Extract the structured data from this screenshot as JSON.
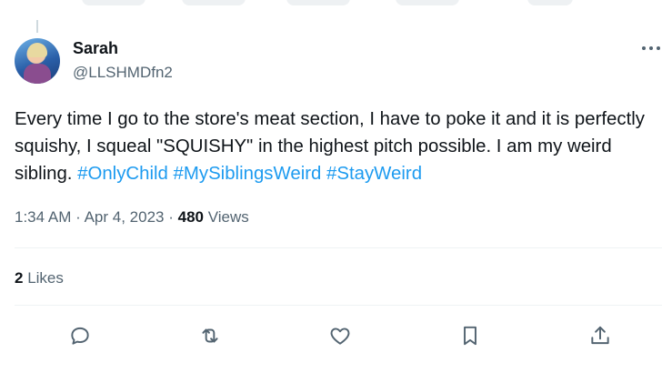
{
  "tweet": {
    "author_name": "Sarah",
    "author_handle": "@LLSHMDfn2",
    "text_plain": "Every time I go to the store's meat section, I have to poke it and it is perfectly squishy, I squeal \"SQUISHY\" in the highest pitch possible. I am my weird sibling. ",
    "hashtags": [
      "#OnlyChild",
      "#MySiblingsWeird",
      "#StayWeird"
    ],
    "time": "1:34 AM",
    "date": "Apr 4, 2023",
    "views_count": "480",
    "views_label": "Views",
    "likes_count": "2",
    "likes_label": "Likes"
  },
  "colors": {
    "accent": "#1d9bf0",
    "secondary_text": "#536471",
    "primary_text": "#0f1419"
  },
  "icons": [
    "more-icon",
    "reply-icon",
    "retweet-icon",
    "like-icon",
    "bookmark-icon",
    "share-icon"
  ]
}
